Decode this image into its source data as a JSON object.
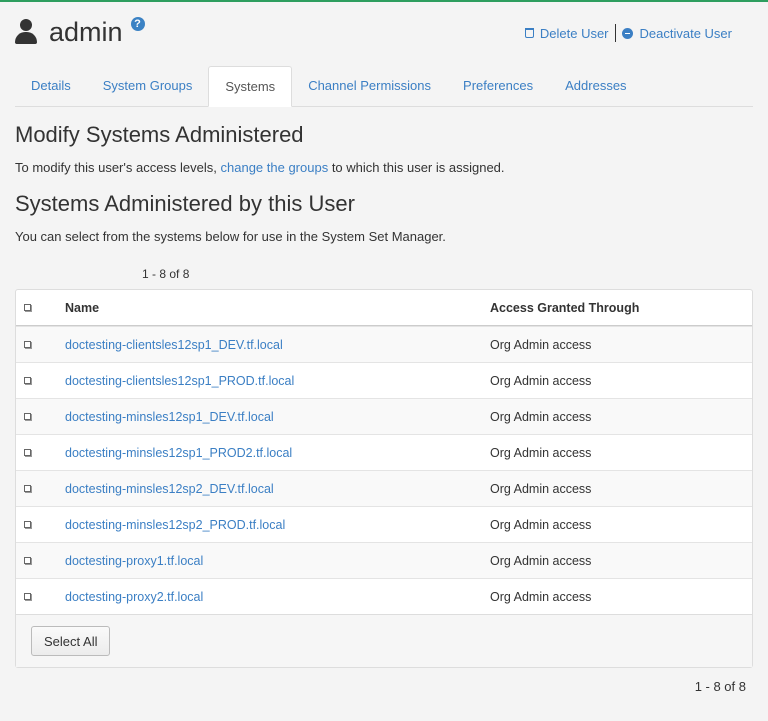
{
  "header": {
    "title": "admin",
    "help_glyph": "?",
    "actions": {
      "delete_label": "Delete User",
      "deactivate_label": "Deactivate User"
    }
  },
  "tabs": [
    {
      "label": "Details",
      "active": false
    },
    {
      "label": "System Groups",
      "active": false
    },
    {
      "label": "Systems",
      "active": true
    },
    {
      "label": "Channel Permissions",
      "active": false
    },
    {
      "label": "Preferences",
      "active": false
    },
    {
      "label": "Addresses",
      "active": false
    }
  ],
  "modify": {
    "heading": "Modify Systems Administered",
    "text_before": "To modify this user's access levels, ",
    "link": "change the groups",
    "text_after": " to which this user is assigned."
  },
  "administered": {
    "heading": "Systems Administered by this User",
    "text": "You can select from the systems below for use in the System Set Manager."
  },
  "pager": {
    "top": "1 - 8 of 8",
    "bottom": "1 - 8 of 8"
  },
  "table": {
    "columns": [
      "Name",
      "Access Granted Through"
    ],
    "rows": [
      {
        "name": "doctesting-clientsles12sp1_DEV.tf.local",
        "access": "Org Admin access"
      },
      {
        "name": "doctesting-clientsles12sp1_PROD.tf.local",
        "access": "Org Admin access"
      },
      {
        "name": "doctesting-minsles12sp1_DEV.tf.local",
        "access": "Org Admin access"
      },
      {
        "name": "doctesting-minsles12sp1_PROD2.tf.local",
        "access": "Org Admin access"
      },
      {
        "name": "doctesting-minsles12sp2_DEV.tf.local",
        "access": "Org Admin access"
      },
      {
        "name": "doctesting-minsles12sp2_PROD.tf.local",
        "access": "Org Admin access"
      },
      {
        "name": "doctesting-proxy1.tf.local",
        "access": "Org Admin access"
      },
      {
        "name": "doctesting-proxy2.tf.local",
        "access": "Org Admin access"
      }
    ],
    "select_all_label": "Select All"
  },
  "colors": {
    "accent": "#3b7fc4",
    "topline": "#2e9e5f"
  },
  "icons": [
    "user-icon",
    "help-icon",
    "trash-icon",
    "minus-circle-icon",
    "checkbox-icon"
  ]
}
